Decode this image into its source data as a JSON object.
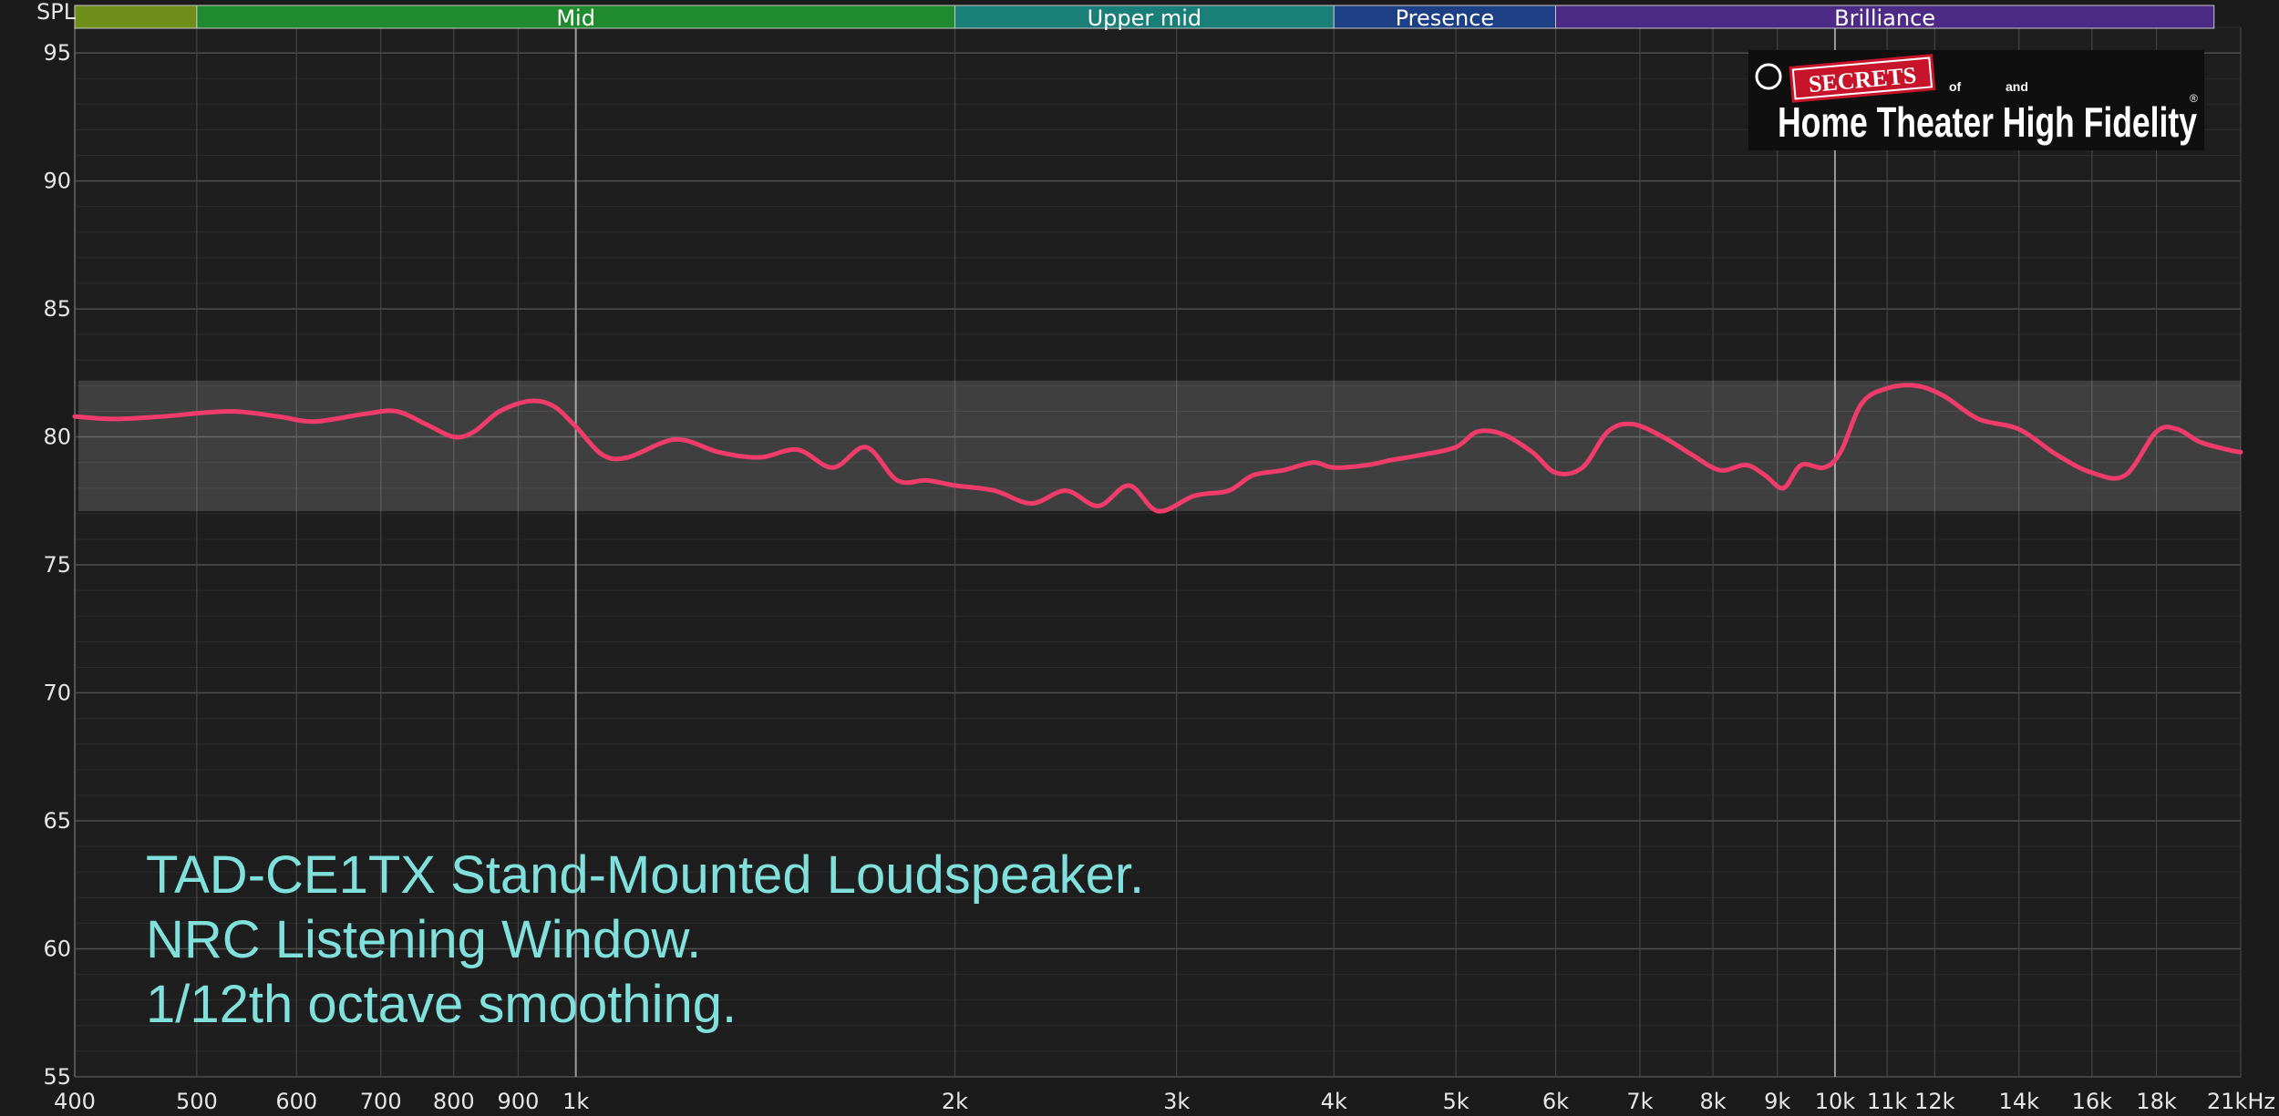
{
  "chart_data": {
    "type": "line",
    "y_axis_label": "SPL",
    "x_scale": "log",
    "xlim_hz": [
      400,
      21000
    ],
    "ylim_db": [
      55,
      96
    ],
    "y_ticks": [
      95,
      90,
      85,
      80,
      75,
      70,
      65,
      60,
      55
    ],
    "x_ticks": [
      {
        "hz": 400,
        "label": "400"
      },
      {
        "hz": 500,
        "label": "500"
      },
      {
        "hz": 600,
        "label": "600"
      },
      {
        "hz": 700,
        "label": "700"
      },
      {
        "hz": 800,
        "label": "800"
      },
      {
        "hz": 900,
        "label": "900"
      },
      {
        "hz": 1000,
        "label": "1k"
      },
      {
        "hz": 2000,
        "label": "2k"
      },
      {
        "hz": 3000,
        "label": "3k"
      },
      {
        "hz": 4000,
        "label": "4k"
      },
      {
        "hz": 5000,
        "label": "5k"
      },
      {
        "hz": 6000,
        "label": "6k"
      },
      {
        "hz": 7000,
        "label": "7k"
      },
      {
        "hz": 8000,
        "label": "8k"
      },
      {
        "hz": 9000,
        "label": "9k"
      },
      {
        "hz": 10000,
        "label": "10k"
      },
      {
        "hz": 11000,
        "label": "11k"
      },
      {
        "hz": 12000,
        "label": "12k"
      },
      {
        "hz": 14000,
        "label": "14k"
      },
      {
        "hz": 16000,
        "label": "16k"
      },
      {
        "hz": 18000,
        "label": "18k"
      },
      {
        "hz": 21000,
        "label": "21kHz"
      }
    ],
    "frequency_bands": [
      {
        "label": "",
        "from_hz": 400,
        "to_hz": 500,
        "color": "#6f8f1a"
      },
      {
        "label": "Mid",
        "from_hz": 500,
        "to_hz": 2000,
        "color": "#1f8a2e"
      },
      {
        "label": "Upper mid",
        "from_hz": 2000,
        "to_hz": 4000,
        "color": "#1a7f78"
      },
      {
        "label": "Presence",
        "from_hz": 4000,
        "to_hz": 6000,
        "color": "#1d3f86"
      },
      {
        "label": "Brilliance",
        "from_hz": 6000,
        "to_hz": 20000,
        "color": "#4d2a85"
      }
    ],
    "tolerance_band_db": [
      77.1,
      82.2
    ],
    "grid": true,
    "series": [
      {
        "color": "#f03c6a",
        "points": [
          [
            400,
            80.8
          ],
          [
            430,
            80.7
          ],
          [
            470,
            80.8
          ],
          [
            530,
            81.0
          ],
          [
            580,
            80.8
          ],
          [
            620,
            80.6
          ],
          [
            680,
            80.9
          ],
          [
            720,
            81.0
          ],
          [
            760,
            80.5
          ],
          [
            800,
            80.0
          ],
          [
            830,
            80.2
          ],
          [
            870,
            81.0
          ],
          [
            920,
            81.4
          ],
          [
            960,
            81.2
          ],
          [
            1000,
            80.4
          ],
          [
            1050,
            79.3
          ],
          [
            1100,
            79.2
          ],
          [
            1200,
            79.9
          ],
          [
            1300,
            79.4
          ],
          [
            1400,
            79.2
          ],
          [
            1500,
            79.5
          ],
          [
            1600,
            78.8
          ],
          [
            1700,
            79.6
          ],
          [
            1800,
            78.3
          ],
          [
            1900,
            78.3
          ],
          [
            2000,
            78.1
          ],
          [
            2150,
            77.9
          ],
          [
            2300,
            77.4
          ],
          [
            2450,
            77.9
          ],
          [
            2600,
            77.3
          ],
          [
            2750,
            78.1
          ],
          [
            2900,
            77.1
          ],
          [
            3100,
            77.7
          ],
          [
            3300,
            77.9
          ],
          [
            3450,
            78.5
          ],
          [
            3650,
            78.7
          ],
          [
            3850,
            79.0
          ],
          [
            4000,
            78.8
          ],
          [
            4250,
            78.9
          ],
          [
            4450,
            79.1
          ],
          [
            4700,
            79.3
          ],
          [
            5000,
            79.6
          ],
          [
            5200,
            80.2
          ],
          [
            5450,
            80.1
          ],
          [
            5750,
            79.4
          ],
          [
            6000,
            78.6
          ],
          [
            6300,
            78.8
          ],
          [
            6600,
            80.2
          ],
          [
            6900,
            80.5
          ],
          [
            7300,
            80.0
          ],
          [
            7700,
            79.3
          ],
          [
            8100,
            78.7
          ],
          [
            8500,
            78.9
          ],
          [
            8800,
            78.5
          ],
          [
            9100,
            78.0
          ],
          [
            9400,
            78.9
          ],
          [
            9800,
            78.8
          ],
          [
            10100,
            79.4
          ],
          [
            10500,
            81.3
          ],
          [
            11000,
            81.9
          ],
          [
            11600,
            82.0
          ],
          [
            12200,
            81.6
          ],
          [
            13000,
            80.7
          ],
          [
            14000,
            80.3
          ],
          [
            15000,
            79.3
          ],
          [
            16000,
            78.6
          ],
          [
            17000,
            78.5
          ],
          [
            18000,
            80.2
          ],
          [
            18700,
            80.3
          ],
          [
            19500,
            79.8
          ],
          [
            20500,
            79.5
          ],
          [
            21000,
            79.4
          ]
        ]
      }
    ],
    "annotations": [
      "TAD-CE1TX Stand-Mounted Loudspeaker.",
      "NRC Listening Window.",
      "1/12th octave smoothing."
    ]
  },
  "watermark": {
    "copyright": "©",
    "secrets": "SECRETS",
    "of": "of",
    "and": "and",
    "line": "Home Theater High Fidelity",
    "registered": "®"
  }
}
